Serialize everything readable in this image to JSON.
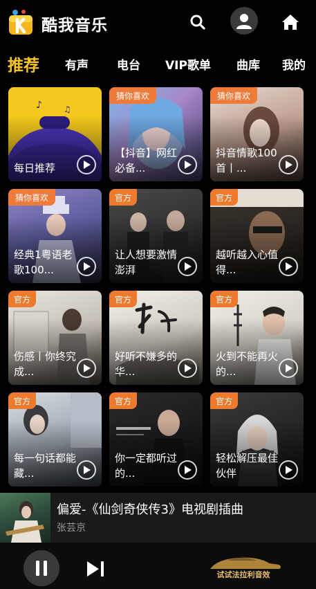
{
  "header": {
    "app_name": "酷我音乐",
    "logo_icon": "kuwo-logo-icon",
    "search_icon": "search-icon",
    "avatar_icon": "avatar-icon",
    "home_icon": "home-icon"
  },
  "tabs": [
    {
      "label": "推荐",
      "active": true
    },
    {
      "label": "有声",
      "active": false
    },
    {
      "label": "电台",
      "active": false
    },
    {
      "label": "VIP歌单",
      "active": false
    },
    {
      "label": "曲库",
      "active": false
    },
    {
      "label": "我的",
      "active": false
    }
  ],
  "cards": [
    {
      "title": "每日推荐",
      "badge": ""
    },
    {
      "title": "【抖音】网红必备...",
      "badge": "猜你喜欢"
    },
    {
      "title": "抖音情歌100首丨...",
      "badge": "猜你喜欢"
    },
    {
      "title": "经典1粤语老歌100...",
      "badge": "猜你喜欢"
    },
    {
      "title": "让人想要激情澎湃",
      "badge": "官方"
    },
    {
      "title": "越听越入心值得...",
      "badge": "官方"
    },
    {
      "title": "伤感丨你终究成...",
      "badge": "官方"
    },
    {
      "title": "好听不嫌多的华...",
      "badge": "官方"
    },
    {
      "title": "火到不能再火的...",
      "badge": "官方"
    },
    {
      "title": "每一句话都能藏...",
      "badge": "官方"
    },
    {
      "title": "你一定都听过的...",
      "badge": "官方"
    },
    {
      "title": "轻松解压最佳伙伴",
      "badge": "官方"
    }
  ],
  "now_playing": {
    "title": "偏爱-《仙剑奇侠传3》电视剧插曲",
    "artist": "张芸京"
  },
  "controls": {
    "pause_icon": "pause-icon",
    "next_icon": "next-track-icon",
    "promo_label": "试试法拉利音效"
  },
  "colors": {
    "accent": "#f8c325",
    "badge": "#ef7b3b",
    "background": "#000000"
  }
}
